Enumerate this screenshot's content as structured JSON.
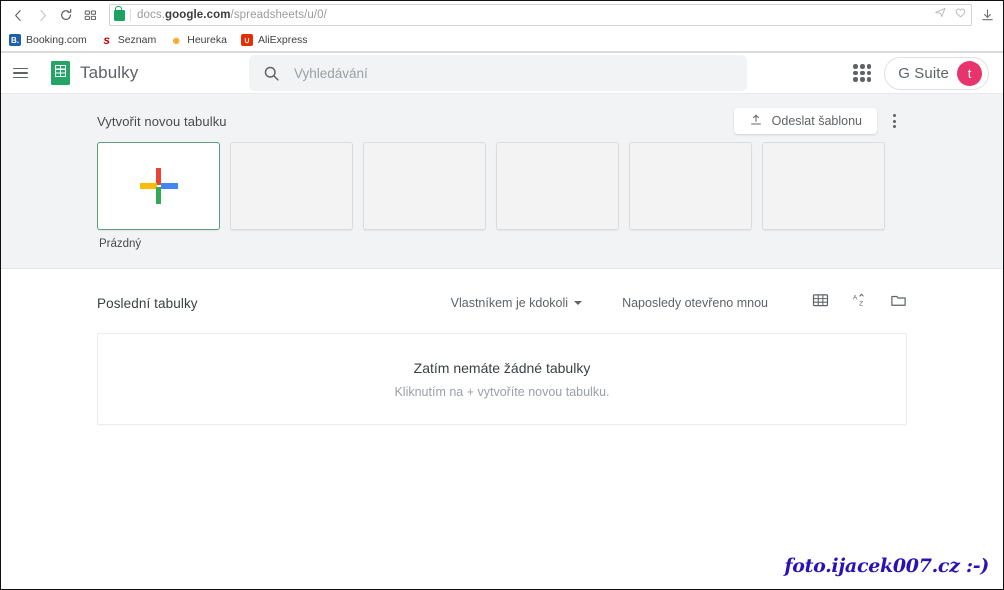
{
  "browser": {
    "nav": {
      "back": "back-arrow",
      "forward": "forward-arrow",
      "reload": "reload-arrow",
      "apps": "apps-grid"
    },
    "url_prefix": "docs.",
    "url_domain": "google.com",
    "url_path": "/spreadsheets/u/0/",
    "omnibox_icons": [
      "send-icon",
      "heart-icon"
    ],
    "toolbar_icons": [
      "download-icon"
    ],
    "bookmarks": [
      {
        "label": "Booking.com",
        "icon": "booking-icon",
        "glyph": "B."
      },
      {
        "label": "Seznam",
        "icon": "seznam-icon",
        "glyph": "s"
      },
      {
        "label": "Heureka",
        "icon": "heureka-icon",
        "glyph": "◉"
      },
      {
        "label": "AliExpress",
        "icon": "aliexpress-icon",
        "glyph": "∪"
      }
    ]
  },
  "app": {
    "title": "Tabulky",
    "menu_icon": "hamburger-menu-icon",
    "logo_icon": "sheets-logo-icon",
    "search": {
      "placeholder": "Vyhledávání",
      "value": "",
      "icon": "search-icon"
    },
    "apps_launcher_icon": "apps-launcher-icon",
    "gsuite_label": "G Suite",
    "avatar_initial": "t",
    "avatar_color": "#e8336d"
  },
  "templates": {
    "heading": "Vytvořit novou tabulku",
    "upload_label": "Odeslat šablonu",
    "upload_icon": "upload-icon",
    "more_icon": "more-vertical-icon",
    "cards": [
      {
        "label": "Prázdný",
        "type": "blank",
        "icon": "google-plus-icon"
      },
      {
        "label": "",
        "type": "placeholder"
      },
      {
        "label": "",
        "type": "placeholder"
      },
      {
        "label": "",
        "type": "placeholder"
      },
      {
        "label": "",
        "type": "placeholder"
      },
      {
        "label": "",
        "type": "placeholder"
      }
    ]
  },
  "recent": {
    "heading": "Poslední tabulky",
    "owner_filter": "Vlastníkem je kdokoli",
    "sort_label": "Naposledy otevřeno mnou",
    "view_icons": [
      "grid-view-icon",
      "sort-az-icon",
      "folder-icon"
    ],
    "empty_title": "Zatím nemáte žádné tabulky",
    "empty_subtitle": "Kliknutím na + vytvoříte novou tabulku."
  },
  "watermark": "foto.ijacek007.cz :-)"
}
